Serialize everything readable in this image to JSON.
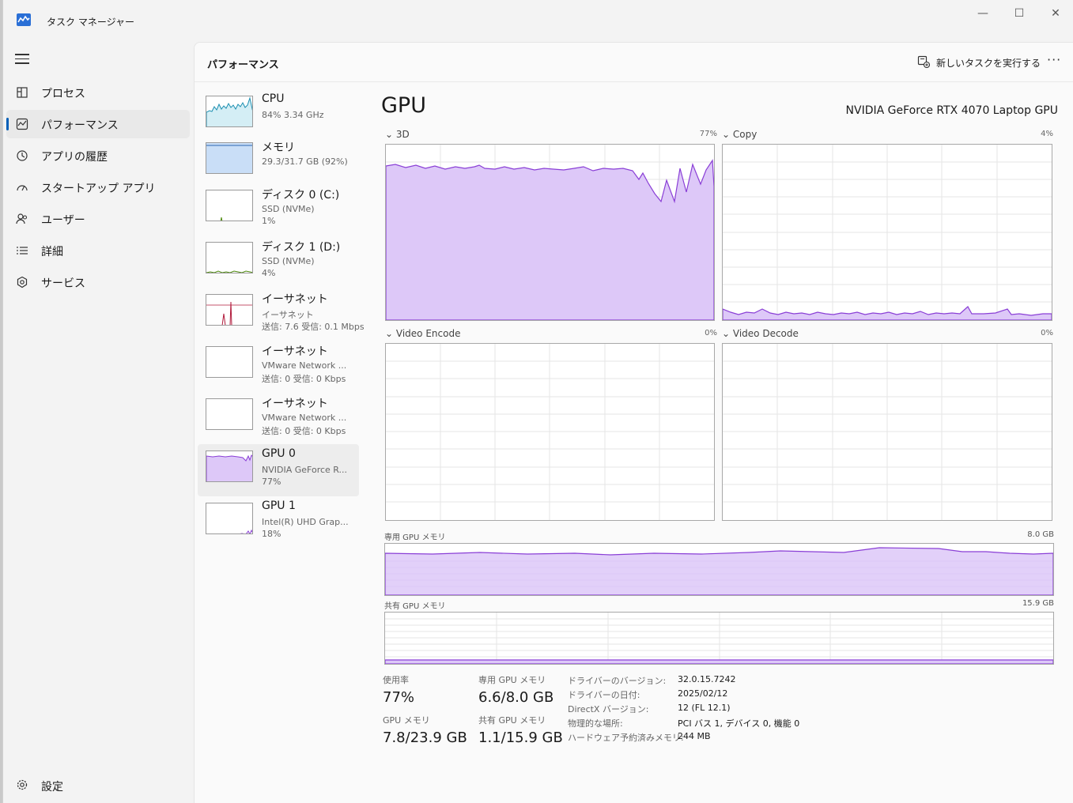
{
  "window": {
    "title": "タスク マネージャー",
    "controls": {
      "minimize": "—",
      "maximize": "☐",
      "close": "✕"
    }
  },
  "colors": {
    "accent": "#005fb8",
    "gpu_fill": "#ddc8f8",
    "gpu_line": "#8a3fd6",
    "cpu_line": "#1b8fb1",
    "disk_line": "#4e8a0e",
    "net_line": "#b11b3c",
    "mem_fill": "#c9def7"
  },
  "sidebar": {
    "items": [
      {
        "label": "プロセス",
        "icon": "processes-icon"
      },
      {
        "label": "パフォーマンス",
        "icon": "performance-icon",
        "active": true
      },
      {
        "label": "アプリの履歴",
        "icon": "app-history-icon"
      },
      {
        "label": "スタートアップ アプリ",
        "icon": "startup-icon"
      },
      {
        "label": "ユーザー",
        "icon": "users-icon"
      },
      {
        "label": "詳細",
        "icon": "details-icon"
      },
      {
        "label": "サービス",
        "icon": "services-icon"
      }
    ],
    "settings_label": "設定"
  },
  "header": {
    "title": "パフォーマンス",
    "new_task_label": "新しいタスクを実行する",
    "more_label": "···"
  },
  "devices": [
    {
      "name": "CPU",
      "sub1": "84%  3.34 GHz",
      "sub2": ""
    },
    {
      "name": "メモリ",
      "sub1": "29.3/31.7 GB (92%)",
      "sub2": ""
    },
    {
      "name": "ディスク 0 (C:)",
      "sub1": "SSD (NVMe)",
      "sub2": "1%"
    },
    {
      "name": "ディスク 1 (D:)",
      "sub1": "SSD (NVMe)",
      "sub2": "4%"
    },
    {
      "name": "イーサネット",
      "sub1": "イーサネット",
      "sub2": "送信: 7.6  受信: 0.1 Mbps"
    },
    {
      "name": "イーサネット",
      "sub1": "VMware Network ...",
      "sub2": "送信: 0  受信: 0 Kbps"
    },
    {
      "name": "イーサネット",
      "sub1": "VMware Network ...",
      "sub2": "送信: 0  受信: 0 Kbps"
    },
    {
      "name": "GPU 0",
      "sub1": "NVIDIA GeForce R...",
      "sub2": "77%",
      "active": true
    },
    {
      "name": "GPU 1",
      "sub1": "Intel(R) UHD Grap...",
      "sub2": "18%"
    }
  ],
  "gpu": {
    "title": "GPU",
    "model": "NVIDIA GeForce RTX 4070 Laptop GPU",
    "engines": [
      {
        "label": "3D",
        "percent": "77%"
      },
      {
        "label": "Copy",
        "percent": "4%"
      },
      {
        "label": "Video Encode",
        "percent": "0%"
      },
      {
        "label": "Video Decode",
        "percent": "0%"
      }
    ],
    "dedicated_label": "専用 GPU メモリ",
    "dedicated_max": "8.0 GB",
    "shared_label": "共有 GPU メモリ",
    "shared_max": "15.9 GB",
    "stats": {
      "usage_label": "使用率",
      "usage_value": "77%",
      "dedicated_label": "専用 GPU メモリ",
      "dedicated_value": "6.6/8.0 GB",
      "gpumem_label": "GPU メモリ",
      "gpumem_value": "7.8/23.9 GB",
      "shared_label": "共有 GPU メモリ",
      "shared_value": "1.1/15.9 GB"
    },
    "details": [
      {
        "key": "ドライバーのバージョン:",
        "value": "32.0.15.7242"
      },
      {
        "key": "ドライバーの日付:",
        "value": "2025/02/12"
      },
      {
        "key": "DirectX バージョン:",
        "value": "12 (FL 12.1)"
      },
      {
        "key": "物理的な場所:",
        "value": "PCI バス 1, デバイス 0, 機能 0"
      },
      {
        "key": "ハードウェア予約済みメモリ:",
        "value": "244 MB"
      }
    ]
  }
}
